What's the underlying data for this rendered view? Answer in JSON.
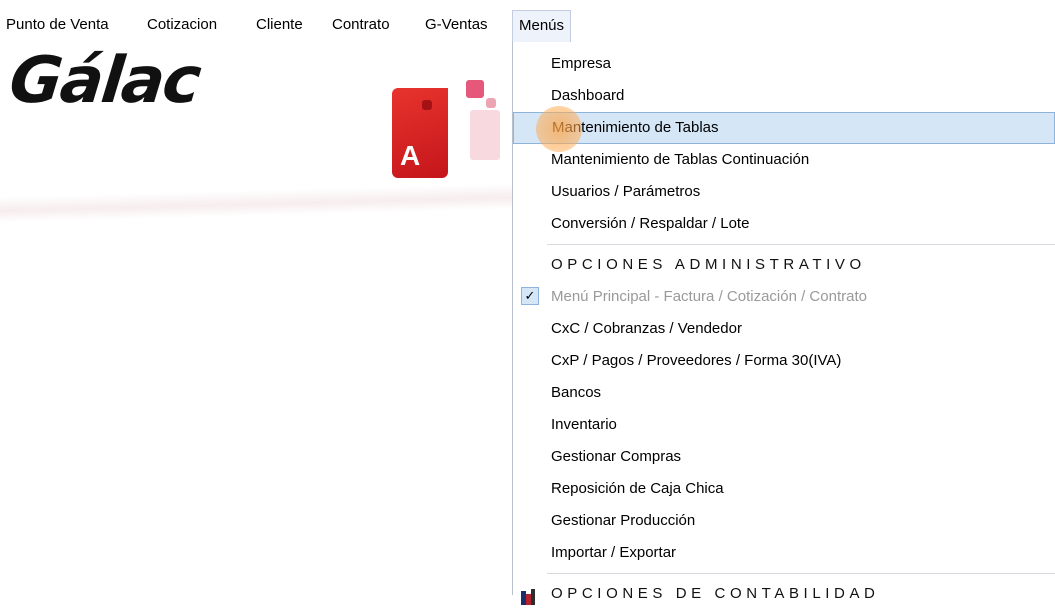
{
  "menubar": {
    "items": [
      {
        "label": "Punto de Venta"
      },
      {
        "label": "Cotizacion"
      },
      {
        "label": "Cliente"
      },
      {
        "label": "Contrato"
      },
      {
        "label": "G-Ventas"
      },
      {
        "label": "Menús"
      }
    ]
  },
  "brand": {
    "wordmark": "Gálac",
    "tile_letter": "A",
    "colors": {
      "red": "#d8201f",
      "pink": "#e6587a"
    }
  },
  "dropdown": {
    "group1": [
      {
        "label": "Empresa"
      },
      {
        "label": "Dashboard"
      },
      {
        "label": "Mantenimiento de Tablas"
      },
      {
        "label": "Mantenimiento de Tablas Continuación"
      },
      {
        "label": "Usuarios / Parámetros"
      },
      {
        "label": "Conversión / Respaldar / Lote"
      }
    ],
    "section_admin": "OPCIONES ADMINISTRATIVO",
    "checked_item": {
      "label": "Menú Principal - Factura / Cotización / Contrato",
      "check_icon": "check-icon"
    },
    "group2": [
      {
        "label": "CxC / Cobranzas / Vendedor"
      },
      {
        "label": "CxP / Pagos / Proveedores / Forma 30(IVA)"
      },
      {
        "label": "Bancos"
      },
      {
        "label": "Inventario"
      },
      {
        "label": "Gestionar Compras"
      },
      {
        "label": "Reposición de Caja Chica"
      },
      {
        "label": "Gestionar Producción"
      },
      {
        "label": "Importar / Exportar"
      }
    ],
    "section_contab": "OPCIONES DE CONTABILIDAD",
    "highlight_color": "#d5e6f7"
  }
}
